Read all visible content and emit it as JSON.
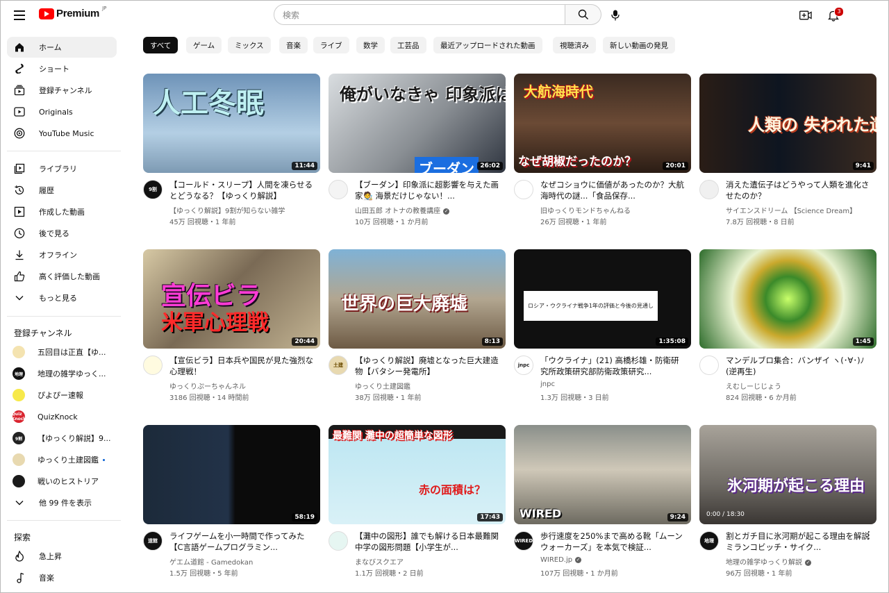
{
  "header": {
    "logo_word": "Premium",
    "logo_region": "JP",
    "search_placeholder": "検索",
    "notification_count": "3"
  },
  "sidebar": {
    "main": [
      {
        "label": "ホーム",
        "icon": "home-icon"
      },
      {
        "label": "ショート",
        "icon": "shorts-icon"
      },
      {
        "label": "登録チャンネル",
        "icon": "subscriptions-icon"
      },
      {
        "label": "Originals",
        "icon": "originals-icon"
      },
      {
        "label": "YouTube Music",
        "icon": "music-icon"
      }
    ],
    "library": [
      {
        "label": "ライブラリ",
        "icon": "library-icon"
      },
      {
        "label": "履歴",
        "icon": "history-icon"
      },
      {
        "label": "作成した動画",
        "icon": "your-videos-icon"
      },
      {
        "label": "後で見る",
        "icon": "watch-later-icon"
      },
      {
        "label": "オフライン",
        "icon": "download-icon"
      },
      {
        "label": "高く評価した動画",
        "icon": "like-icon"
      },
      {
        "label": "もっと見る",
        "icon": "chevron-down-icon"
      }
    ],
    "subs_heading": "登録チャンネル",
    "subs": [
      {
        "label": "五回目は正直【ゆ...",
        "color": "#f4e3b0",
        "fg": "#b07a00",
        "short": ""
      },
      {
        "label": "地理の雑学ゆっく...",
        "color": "#111111",
        "fg": "#ffffff",
        "short": "地理"
      },
      {
        "label": "ぴよぴー速報",
        "color": "#f7e94a",
        "fg": "#338833",
        "short": ""
      },
      {
        "label": "QuizKnock",
        "color": "#d9232e",
        "fg": "#ffffff",
        "short": "Quiz Knock"
      },
      {
        "label": "【ゆっくり解説】9...",
        "color": "#222222",
        "fg": "#ffffff",
        "short": "9割"
      },
      {
        "label": "ゆっくり土建図鑑",
        "color": "#e8d9b0",
        "fg": "#6b4b00",
        "short": ""
      },
      {
        "label": "戦いのヒストリア",
        "color": "#1a1a1a",
        "fg": "#ffffff",
        "short": ""
      }
    ],
    "show_more": "他 99 件を表示",
    "explore_heading": "探索",
    "explore": [
      {
        "label": "急上昇",
        "icon": "trending-icon"
      },
      {
        "label": "音楽",
        "icon": "music-note-icon"
      }
    ]
  },
  "chips": [
    "すべて",
    "ゲーム",
    "ミックス",
    "音楽",
    "ライブ",
    "数学",
    "工芸品",
    "最近アップロードされた動画",
    "視聴済み",
    "新しい動画の発見"
  ],
  "videos": [
    {
      "title": "【コールド・スリープ】人間を凍らせるとどうなる？【ゆっくり解説】",
      "channel": "【ゆっくり解説】9割が知らない雑学",
      "meta": "45万 回視聴・1 年前",
      "duration": "11:44",
      "thumb_text": "人工冬眠",
      "verified": false
    },
    {
      "title": "【ブーダン】印象派に超影響を与えた画家🧑‍🎨 海景だけじゃない！...",
      "channel": "山田五郎 オトナの教養講座",
      "meta": "10万 回視聴・1 か月前",
      "duration": "26:02",
      "thumb_text": "俺がいなきゃ 印象派はねぇ！",
      "thumb_sub": "ブーダン",
      "verified": true
    },
    {
      "title": "なぜコショウに価値があったのか？大航海時代の謎...「食品保存...",
      "channel": "旧ゆっくりモンドちゃんねる",
      "meta": "26万 回視聴・1 年前",
      "duration": "20:01",
      "thumb_text": "大航海時代",
      "thumb_sub": "なぜ胡椒だったのか？",
      "verified": false
    },
    {
      "title": "消えた遺伝子はどうやって人類を進化させたのか？",
      "channel": "サイエンスドリーム 【Science Dream】",
      "meta": "7.8万 回視聴・8 日前",
      "duration": "9:41",
      "thumb_text": "人類の 失われた遺伝子",
      "verified": false
    },
    {
      "title": "【宣伝ビラ】日本兵や国民が見た強烈な心理戦！",
      "channel": "ゆっくりぷーちゃんネル",
      "meta": "3186 回視聴・14 時間前",
      "duration": "20:44",
      "thumb_text": "宣伝ビラ",
      "thumb_sub": "米軍心理戦",
      "verified": false
    },
    {
      "title": "【ゆっくり解説】廃墟となった巨大建造物【バタシー発電所】",
      "channel": "ゆっくり土建図鑑",
      "meta": "38万 回視聴・1 年前",
      "duration": "8:13",
      "thumb_text": "世界の巨大廃墟",
      "verified": false
    },
    {
      "title": "「ウクライナ」(21) 高橋杉雄・防衛研究所政策研究部防衛政策研究...",
      "channel": "jnpc",
      "meta": "1.3万 回視聴・3 日前",
      "duration": "1:35:08",
      "thumb_text": "ロシア・ウクライナ戦争1年の評価と今後の見通し",
      "verified": false
    },
    {
      "title": "マンデルブロ集合：バンザイ ヽ(･∀･)ﾉ (逆再生)",
      "channel": "えむしーじじょう",
      "meta": "824 回視聴・6 か月前",
      "duration": "1:45",
      "thumb_text": "",
      "verified": false
    },
    {
      "title": "ライフゲームを小一時間で作ってみた【C言語ゲームプログラミン...",
      "channel": "ゲエム道館 - Gamedokan",
      "meta": "1.5万 回視聴・5 年前",
      "duration": "58:19",
      "thumb_text": "",
      "verified": false
    },
    {
      "title": "【灘中の図形】誰でも解ける日本最難関中学の図形問題【小学生が...",
      "channel": "まなびスクエア",
      "meta": "1.1万 回視聴・2 日前",
      "duration": "17:43",
      "thumb_text": "最難関 灘中の超簡単な図形",
      "thumb_sub": "赤の面積は？",
      "verified": false
    },
    {
      "title": "歩行速度を250%まで高める靴「ムーンウォーカーズ」を本気で検証...",
      "channel": "WIRED.jp",
      "meta": "107万 回視聴・1 か月前",
      "duration": "9:24",
      "thumb_text": "WIRED",
      "verified": true
    },
    {
      "title": "割とガチ目に氷河期が起こる理由を解説　ミランコビッチ・サイク...",
      "channel": "地理の雑学ゆっくり解説",
      "meta": "96万 回視聴・1 年前",
      "duration": "",
      "thumb_text": "氷河期が起こる理由",
      "thumb_sub": "0:00 / 18:30",
      "verified": true
    }
  ]
}
